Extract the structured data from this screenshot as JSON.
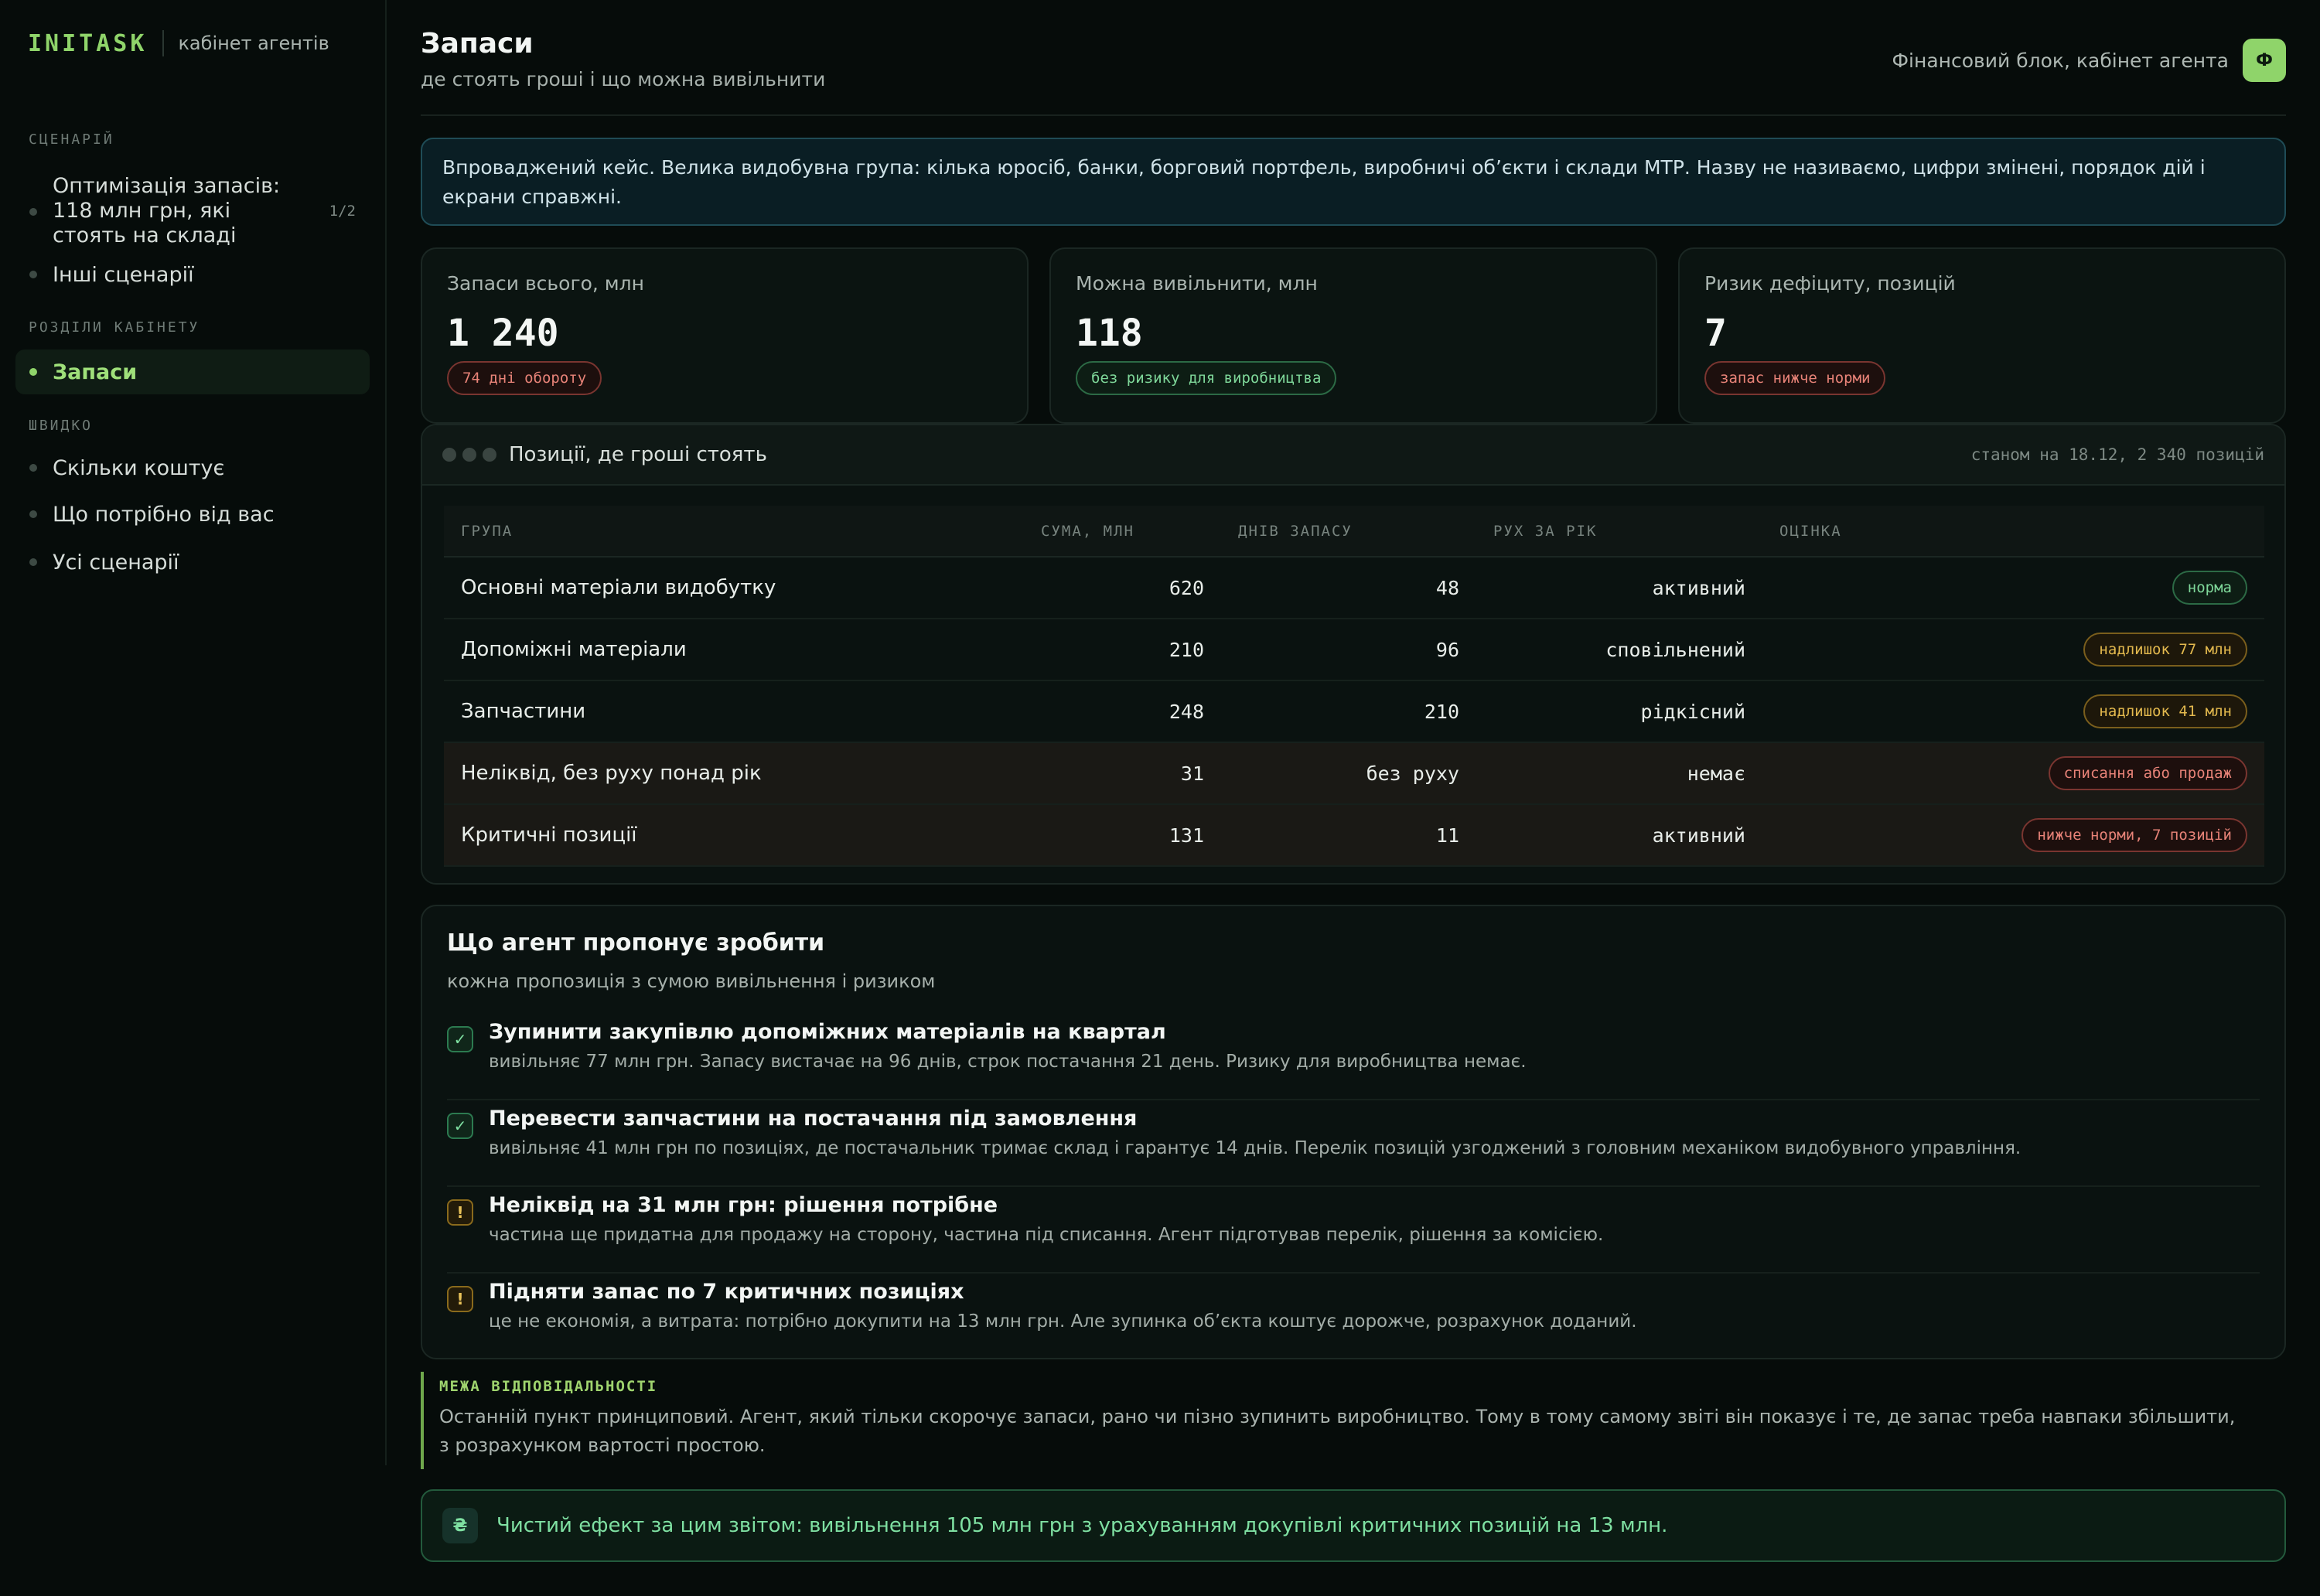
{
  "brand": {
    "logo": "INITASK",
    "subtitle": "кабінет агентів"
  },
  "sidebar": {
    "scenarios_title": "СЦЕНАРІЙ",
    "scenarios": [
      {
        "label": "Оптимізація запасів: 118 млн грн, які стоять на складі",
        "count": "1/2"
      },
      {
        "label": "Інші сценарії"
      }
    ],
    "sections_title": "РОЗДІЛИ КАБІНЕТУ",
    "sections": [
      {
        "label": "Запаси"
      }
    ],
    "quick_title": "ШВИДКО",
    "quick": [
      {
        "label": "Скільки коштує"
      },
      {
        "label": "Що потрібно від вас"
      },
      {
        "label": "Усі сценарії"
      }
    ]
  },
  "header": {
    "title": "Запаси",
    "subtitle": "де стоять гроші і що можна вивільнити",
    "account": "Фінансовий блок, кабінет агента",
    "avatar": "Ф"
  },
  "notice": "Впроваджений кейс. Велика видобувна група: кілька юросіб, банки, борговий портфель, виробничі об’єкти і склади МТР. Назву не називаємо, цифри змінені, порядок дій і екрани справжні.",
  "stats": [
    {
      "label": "Запаси всього, млн",
      "value": "1 240",
      "pill": "74 дні обороту",
      "tone": "red"
    },
    {
      "label": "Можна вивільнити, млн",
      "value": "118",
      "pill": "без ризику для виробництва",
      "tone": "green"
    },
    {
      "label": "Ризик дефіциту, позицій",
      "value": "7",
      "pill": "запас нижче норми",
      "tone": "red"
    }
  ],
  "table": {
    "title": "Позиції, де гроші стоять",
    "meta": "станом на 18.12, 2 340 позицій",
    "columns": [
      "ГРУПА",
      "СУМА, МЛН",
      "ДНІВ ЗАПАСУ",
      "РУХ ЗА РІК",
      "ОЦІНКА"
    ],
    "rows": [
      {
        "group": "Основні матеріали видобутку",
        "sum": "620",
        "days": "48",
        "move": "активний",
        "rating": "норма",
        "tone": "green",
        "hl": false
      },
      {
        "group": "Допоміжні матеріали",
        "sum": "210",
        "days": "96",
        "move": "сповільнений",
        "rating": "надлишок 77 млн",
        "tone": "amber",
        "hl": false
      },
      {
        "group": "Запчастини",
        "sum": "248",
        "days": "210",
        "move": "рідкісний",
        "rating": "надлишок 41 млн",
        "tone": "amber",
        "hl": false
      },
      {
        "group": "Неліквід, без руху понад рік",
        "sum": "31",
        "days": "без руху",
        "move": "немає",
        "rating": "списання або продаж",
        "tone": "red",
        "hl": true
      },
      {
        "group": "Критичні позиції",
        "sum": "131",
        "days": "11",
        "move": "активний",
        "rating": "нижче норми, 7 позицій",
        "tone": "red",
        "hl": true
      }
    ]
  },
  "proposals": {
    "title": "Що агент пропонує зробити",
    "subtitle": "кожна пропозиція з сумою вивільнення і ризиком",
    "items": [
      {
        "icon": "✓",
        "kind": "ok",
        "title": "Зупинити закупівлю допоміжних матеріалів на квартал",
        "desc": "вивільняє 77 млн грн. Запасу вистачає на 96 днів, строк постачання 21 день. Ризику для виробництва немає."
      },
      {
        "icon": "✓",
        "kind": "ok",
        "title": "Перевести запчастини на постачання під замовлення",
        "desc": "вивільняє 41 млн грн по позиціях, де постачальник тримає склад і гарантує 14 днів. Перелік позицій узгоджений з головним механіком видобувного управління."
      },
      {
        "icon": "!",
        "kind": "warn",
        "title": "Неліквід на 31 млн грн: рішення потрібне",
        "desc": "частина ще придатна для продажу на сторону, частина під списання. Агент підготував перелік, рішення за комісією."
      },
      {
        "icon": "!",
        "kind": "warn",
        "title": "Підняти запас по 7 критичних позиціях",
        "desc": "це не економія, а витрата: потрібно докупити на 13 млн грн. Але зупинка об’єкта коштує дорожче, розрахунок доданий."
      }
    ]
  },
  "responsibility": {
    "title": "МЕЖА ВІДПОВІДАЛЬНОСТІ",
    "text": "Останній пункт принциповий. Агент, який тільки скорочує запаси, рано чи пізно зупинить виробництво. Тому в тому самому звіті він показує і те, де запас треба навпаки збільшити, з розрахунком вартості простою."
  },
  "result": {
    "icon": "₴",
    "text": "Чистий ефект за цим звітом: вивільнення 105 млн грн з урахуванням докупівлі критичних позицій на 13 млн."
  }
}
